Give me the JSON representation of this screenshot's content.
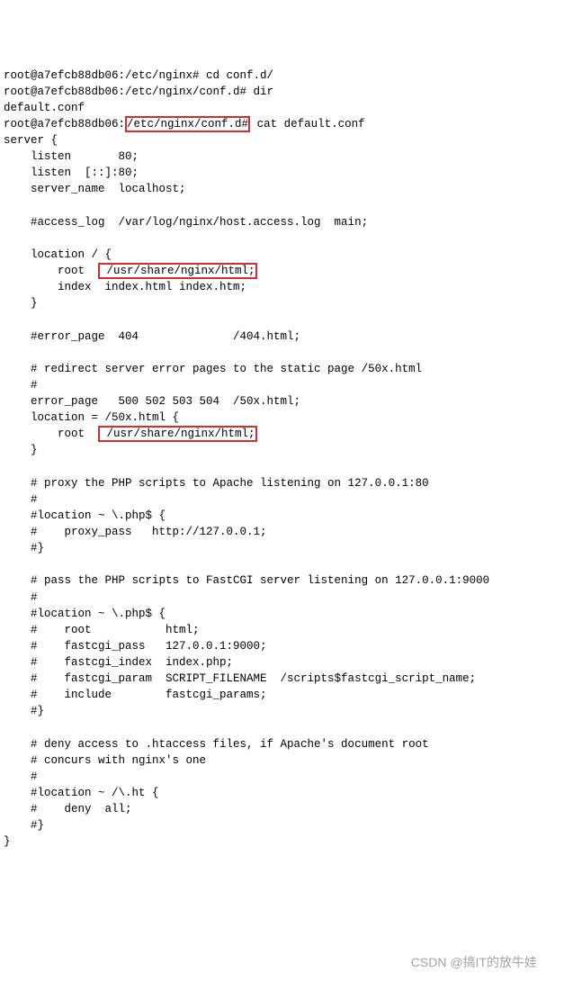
{
  "lines": {
    "l0_a": "root@a7efcb88db06:/etc/nginx# ",
    "l0_b": "cd conf.d/",
    "l1_a": "root@a7efcb88db06:/etc/nginx/conf.d# ",
    "l1_b": "dir",
    "l2": "default.conf",
    "l3_a": "root@a7efcb88db06:",
    "l3_hl": "/etc/nginx/conf.d#",
    "l3_b": " cat default.conf",
    "l4": "server {",
    "l5": "    listen       80;",
    "l6": "    listen  [::]:80;",
    "l7": "    server_name  localhost;",
    "l8": "",
    "l9": "    #access_log  /var/log/nginx/host.access.log  main;",
    "l10": "",
    "l11": "    location / {",
    "l12_a": "        root  ",
    "l12_hl": " /usr/share/nginx/html;",
    "l13": "        index  index.html index.htm;",
    "l14": "    }",
    "l15": "",
    "l16": "    #error_page  404              /404.html;",
    "l17": "",
    "l18": "    # redirect server error pages to the static page /50x.html",
    "l19": "    #",
    "l20": "    error_page   500 502 503 504  /50x.html;",
    "l21": "    location = /50x.html {",
    "l22_a": "        root  ",
    "l22_hl": " /usr/share/nginx/html;",
    "l23": "    }",
    "l24": "",
    "l25": "    # proxy the PHP scripts to Apache listening on 127.0.0.1:80",
    "l26": "    #",
    "l27": "    #location ~ \\.php$ {",
    "l28": "    #    proxy_pass   http://127.0.0.1;",
    "l29": "    #}",
    "l30": "",
    "l31": "    # pass the PHP scripts to FastCGI server listening on 127.0.0.1:9000",
    "l32": "    #",
    "l33": "    #location ~ \\.php$ {",
    "l34": "    #    root           html;",
    "l35": "    #    fastcgi_pass   127.0.0.1:9000;",
    "l36": "    #    fastcgi_index  index.php;",
    "l37": "    #    fastcgi_param  SCRIPT_FILENAME  /scripts$fastcgi_script_name;",
    "l38": "    #    include        fastcgi_params;",
    "l39": "    #}",
    "l40": "",
    "l41": "    # deny access to .htaccess files, if Apache's document root",
    "l42": "    # concurs with nginx's one",
    "l43": "    #",
    "l44": "    #location ~ /\\.ht {",
    "l45": "    #    deny  all;",
    "l46": "    #}",
    "l47": "}"
  },
  "watermark": "CSDN @搞IT的放牛娃"
}
